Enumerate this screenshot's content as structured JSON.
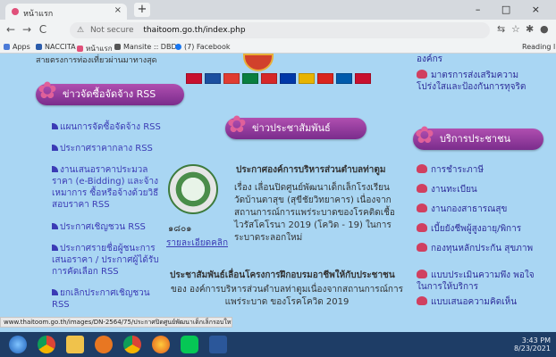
{
  "browser": {
    "tab_title": "หน้าแรก",
    "close_glyph": "×",
    "new_tab_glyph": "+",
    "window_controls": "– □ ×",
    "nav": {
      "back": "←",
      "forward": "→",
      "reload": "C"
    },
    "address": {
      "security": "Not secure",
      "url": "thaitoom.go.th/index.php"
    },
    "bookmarks": [
      "Apps",
      "NACCITA",
      "หน้าแรก",
      "Mansite :: DBD",
      "(7) Facebook"
    ],
    "reading_list": "Reading li"
  },
  "page": {
    "top_text": "สายตรงการท่องเที่ยวผ่านมาทางสุด",
    "left": {
      "header": "ข่าวจัดซื้อจัดจ้าง RSS",
      "links": [
        "แผนการจัดซื้อจัดจ้าง RSS",
        "ประกาศราคากลาง RSS",
        "งานเสนอราคาประมวลราคา (e-Bidding) และจ้างเหมาการ ซื้อหรือจ้างด้วยวิธีสอบราคา RSS",
        "ประกาศเชิญชวน RSS",
        "ประกาศรายชื่อผู้ชนะการ เสนอราคา / ประกาศผู้ได้รับ การคัดเลือก RSS",
        "ยกเลิกประกาศเชิญชวน RSS"
      ]
    },
    "center": {
      "header": "ข่าวประชาสัมพันธ์",
      "news_title": "ประกาศองค์การบริหารส่วนตำบลท่าตูม",
      "news_body": "เรื่อง เลื่อนปิดศูนย์พัฒนาเด็กเล็กโรงเรียน วัดบ้านตาสุข (สุขีชัยวิทยาคาร) เนื่องจาก สถานการณ์การแพร่ระบาดของโรคติดเชื้อไวรัสโคโรนา 2019 (โควิด - 19) ในการระบาดระลอกใหม่",
      "count": "๑๘๐๑",
      "read_more": "รายละเอียดคลิก",
      "bottom_title": "ประชาสัมพันธ์เลื่อนโครงการฝึกอบรมอาชีพให้กับประชาชน",
      "bottom_body": "ของ องค์การบริหารส่วนตำบลท่าตูมเนื่องจากสถานการณ์การแพร่ระบาด ของโรคโควิด 2019"
    },
    "right": {
      "top_cut": "องค์กร",
      "header": "บริการประชาชน",
      "items": [
        "มาตรการส่งเสริมความ โปร่งใสและป้องกันการทุจริต",
        "การชำระภาษี",
        "งานทะเบียน",
        "งานกองสาธารณสุข",
        "เบี้ยยังชีพผู้สูงอายุ/พิการ",
        "กองทุนหลักประกัน สุขภาพ",
        "แบบประเมินความพึง พอใจในการให้บริการ",
        "แบบเสนอความคิดเห็น"
      ]
    },
    "status_url": "www.thaitoom.go.th/images/DN-2564/75/ประกาศปิดศูนย์พัฒนาเด็กเล็กรอบใหม่.pdf"
  },
  "flags": [
    "#c8102e",
    "#1b4fa0",
    "#e03c31",
    "#0a7f3f",
    "#d62828",
    "#0038a8",
    "#e8b400",
    "#da251d",
    "#005bac",
    "#c8102e"
  ],
  "colors": {
    "page_bg": "#a9d6f3",
    "banner": "#8e3a9e",
    "link": "#3b3bb5"
  },
  "taskbar": {
    "tray_time": "3:43 PM",
    "tray_date": "8/23/2021",
    "app_icons": [
      "windows-start-icon",
      "chrome-icon",
      "file-explorer-icon",
      "media-icon",
      "chrome-icon",
      "firefox-icon",
      "line-icon",
      "word-icon"
    ]
  }
}
